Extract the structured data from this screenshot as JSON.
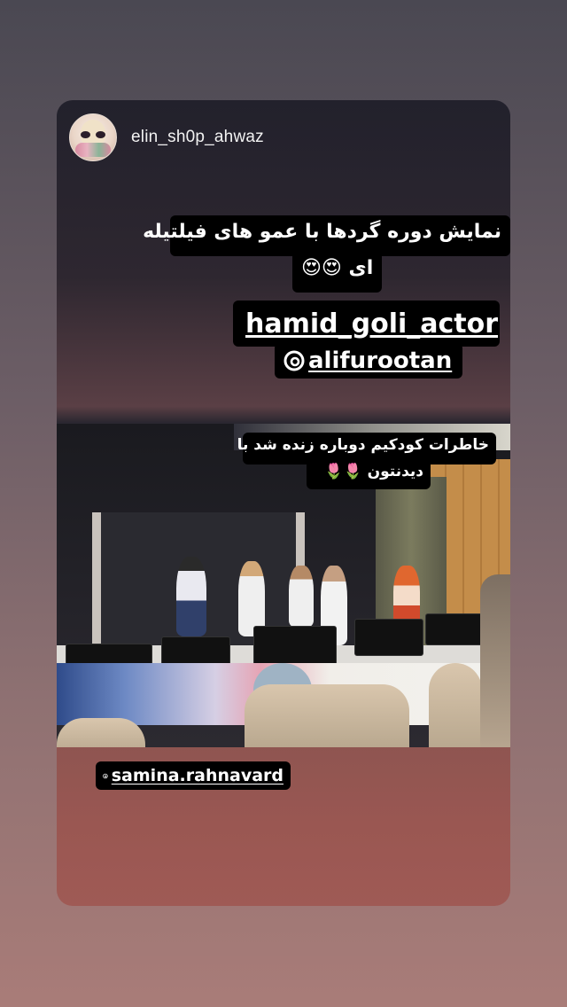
{
  "story": {
    "username": "elin_sh0p_ahwaz",
    "caption_line1": "نمایش دوره گردها با عمو های فیلتیله",
    "caption_line2": "ای 😍😍",
    "mentions": [
      "hamid_goli_actor",
      "alifurootan"
    ],
    "photo_caption_line1": "خاطرات کودکیم دوباره زنده شد با",
    "photo_caption_line2": "دیدنتون 🌷🌷",
    "bottom_mention": "samina.rahnavard"
  },
  "icons": {
    "mention_icon": "threads-icon",
    "avatar": "avatar"
  },
  "colors": {
    "sticker_bg": "#000000",
    "text": "#ffffff",
    "username": "#f2f2f2"
  }
}
